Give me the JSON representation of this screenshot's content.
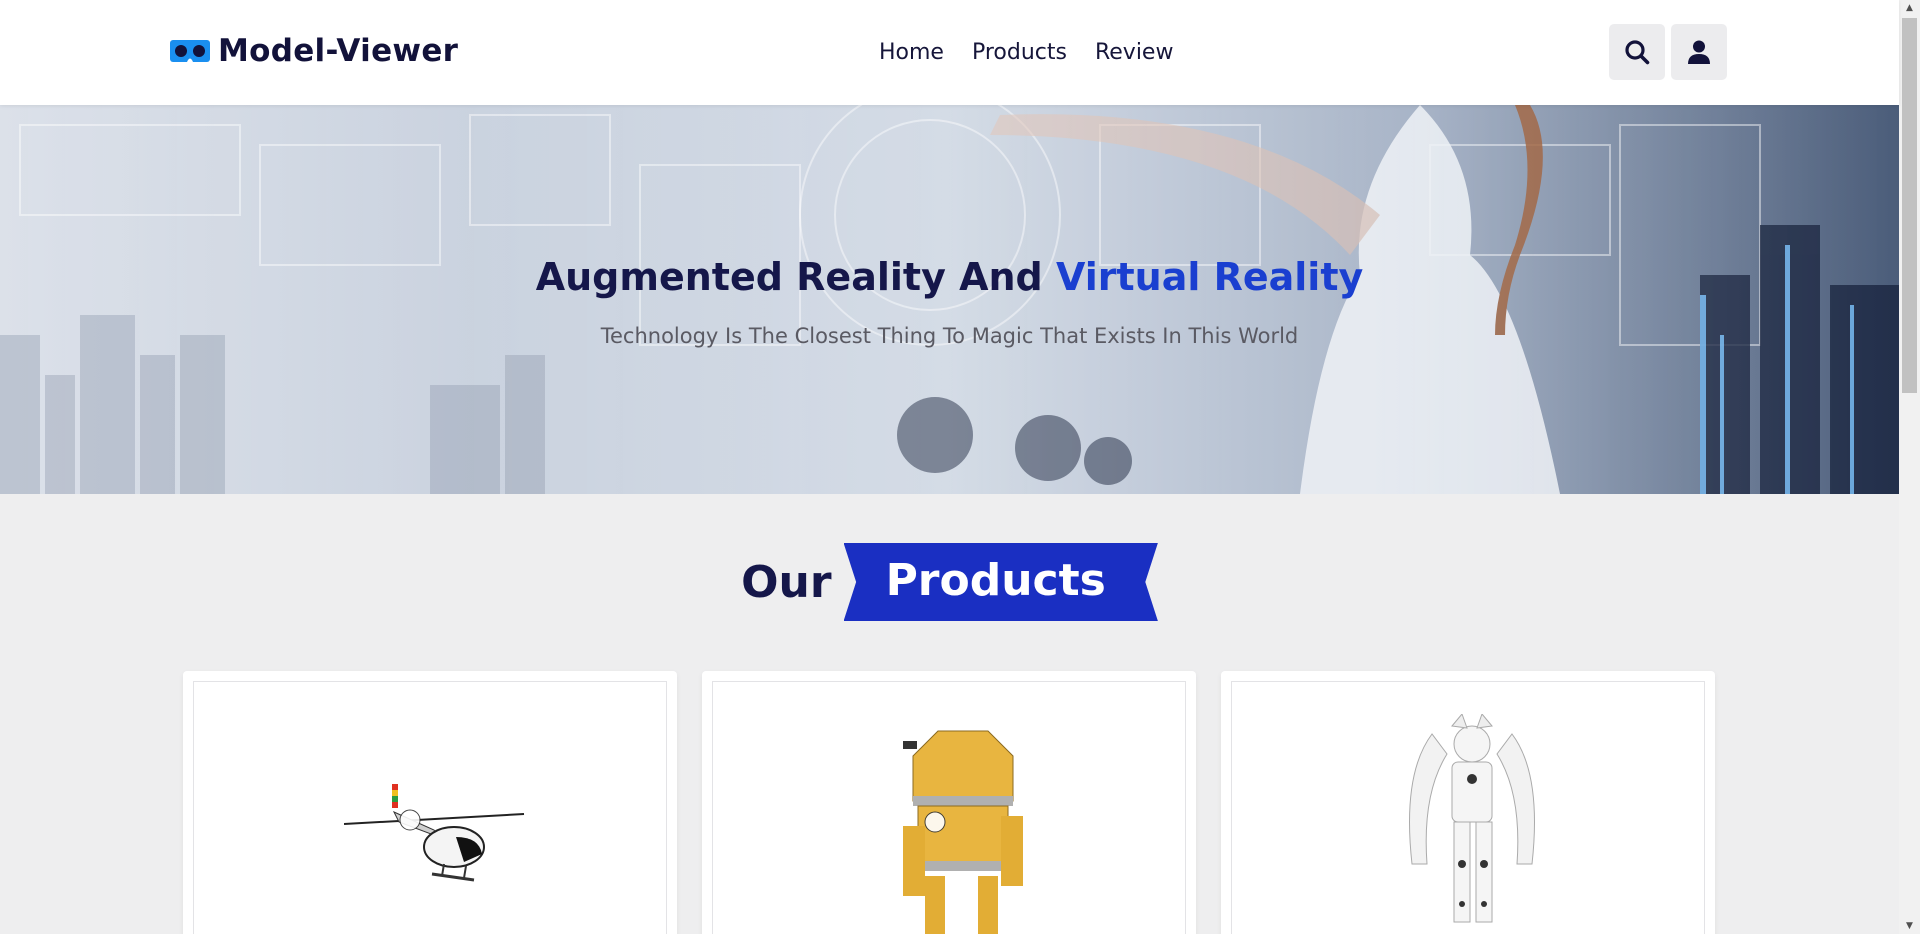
{
  "header": {
    "logo_text": "Model-Viewer",
    "nav": [
      "Home",
      "Products",
      "Review"
    ],
    "search_icon": "search-icon",
    "user_icon": "user-icon"
  },
  "hero": {
    "title_part1": "Augmented Reality And ",
    "title_accent": "Virtual Reality",
    "subtitle": "Technology Is The Closest Thing To Magic That Exists In This World"
  },
  "products_section": {
    "heading_plain": "Our",
    "heading_badge": "Products"
  },
  "products": [
    {
      "model": "helicopter"
    },
    {
      "model": "yellow-robot"
    },
    {
      "model": "white-robot"
    }
  ],
  "colors": {
    "primary_dark": "#15174a",
    "accent_blue": "#1a3fd0",
    "badge_blue": "#1a2fc2",
    "page_bg": "#eeeeef"
  }
}
